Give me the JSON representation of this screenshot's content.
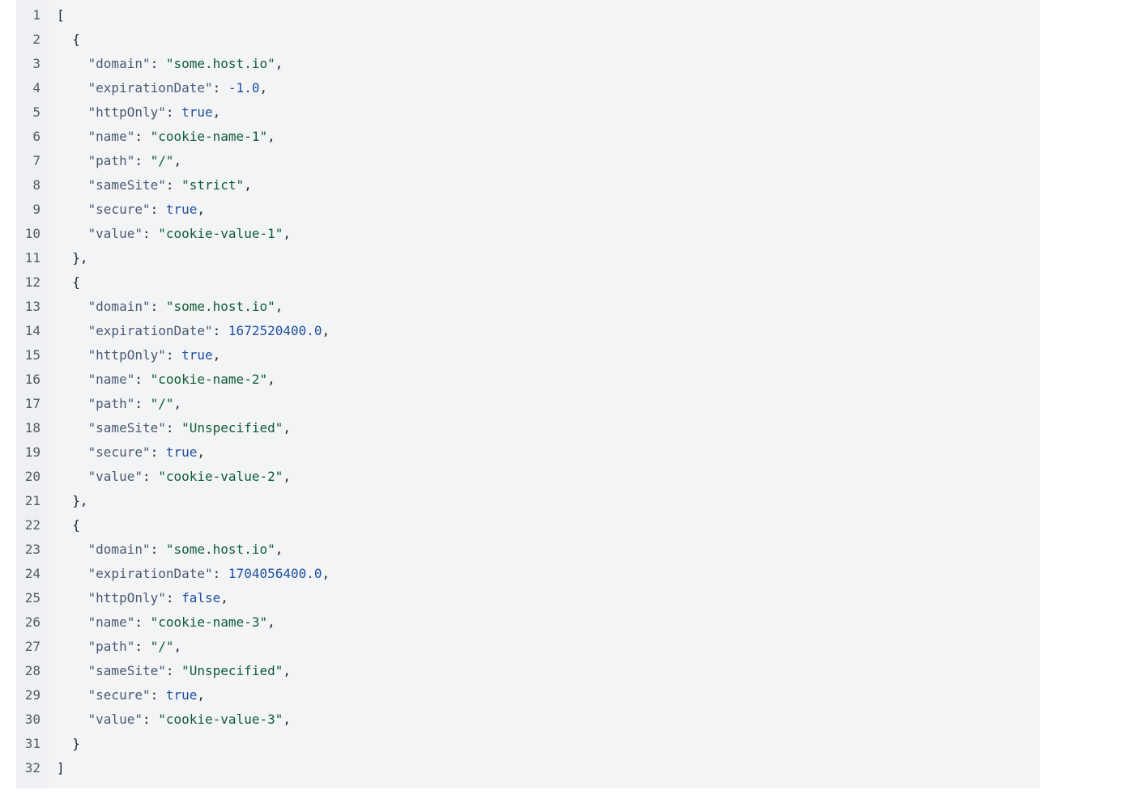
{
  "colors": {
    "background": "#ffffff",
    "code_bg": "#f3f4f6",
    "gutter_bg": "#eef0f3",
    "line_number": "#555b63",
    "key": "#4a5a73",
    "string": "#0f5c36",
    "number": "#1f4fa0",
    "keyword": "#1f4fa0",
    "punctuation": "#24292e"
  },
  "lines": [
    {
      "n": "1",
      "tokens": [
        {
          "t": "punc",
          "v": "["
        }
      ]
    },
    {
      "n": "2",
      "tokens": [
        {
          "t": "indent",
          "v": "  "
        },
        {
          "t": "punc",
          "v": "{"
        }
      ]
    },
    {
      "n": "3",
      "tokens": [
        {
          "t": "indent",
          "v": "    "
        },
        {
          "t": "key",
          "v": "\"domain\""
        },
        {
          "t": "punc",
          "v": ": "
        },
        {
          "t": "str",
          "v": "\"some.host.io\""
        },
        {
          "t": "punc",
          "v": ","
        }
      ]
    },
    {
      "n": "4",
      "tokens": [
        {
          "t": "indent",
          "v": "    "
        },
        {
          "t": "key",
          "v": "\"expirationDate\""
        },
        {
          "t": "punc",
          "v": ": "
        },
        {
          "t": "num",
          "v": "-1.0"
        },
        {
          "t": "punc",
          "v": ","
        }
      ]
    },
    {
      "n": "5",
      "tokens": [
        {
          "t": "indent",
          "v": "    "
        },
        {
          "t": "key",
          "v": "\"httpOnly\""
        },
        {
          "t": "punc",
          "v": ": "
        },
        {
          "t": "kw",
          "v": "true"
        },
        {
          "t": "punc",
          "v": ","
        }
      ]
    },
    {
      "n": "6",
      "tokens": [
        {
          "t": "indent",
          "v": "    "
        },
        {
          "t": "key",
          "v": "\"name\""
        },
        {
          "t": "punc",
          "v": ": "
        },
        {
          "t": "str",
          "v": "\"cookie-name-1\""
        },
        {
          "t": "punc",
          "v": ","
        }
      ]
    },
    {
      "n": "7",
      "tokens": [
        {
          "t": "indent",
          "v": "    "
        },
        {
          "t": "key",
          "v": "\"path\""
        },
        {
          "t": "punc",
          "v": ": "
        },
        {
          "t": "str",
          "v": "\"/\""
        },
        {
          "t": "punc",
          "v": ","
        }
      ]
    },
    {
      "n": "8",
      "tokens": [
        {
          "t": "indent",
          "v": "    "
        },
        {
          "t": "key",
          "v": "\"sameSite\""
        },
        {
          "t": "punc",
          "v": ": "
        },
        {
          "t": "str",
          "v": "\"strict\""
        },
        {
          "t": "punc",
          "v": ","
        }
      ]
    },
    {
      "n": "9",
      "tokens": [
        {
          "t": "indent",
          "v": "    "
        },
        {
          "t": "key",
          "v": "\"secure\""
        },
        {
          "t": "punc",
          "v": ": "
        },
        {
          "t": "kw",
          "v": "true"
        },
        {
          "t": "punc",
          "v": ","
        }
      ]
    },
    {
      "n": "10",
      "tokens": [
        {
          "t": "indent",
          "v": "    "
        },
        {
          "t": "key",
          "v": "\"value\""
        },
        {
          "t": "punc",
          "v": ": "
        },
        {
          "t": "str",
          "v": "\"cookie-value-1\""
        },
        {
          "t": "punc",
          "v": ","
        }
      ]
    },
    {
      "n": "11",
      "tokens": [
        {
          "t": "indent",
          "v": "  "
        },
        {
          "t": "punc",
          "v": "},"
        }
      ]
    },
    {
      "n": "12",
      "tokens": [
        {
          "t": "indent",
          "v": "  "
        },
        {
          "t": "punc",
          "v": "{"
        }
      ]
    },
    {
      "n": "13",
      "tokens": [
        {
          "t": "indent",
          "v": "    "
        },
        {
          "t": "key",
          "v": "\"domain\""
        },
        {
          "t": "punc",
          "v": ": "
        },
        {
          "t": "str",
          "v": "\"some.host.io\""
        },
        {
          "t": "punc",
          "v": ","
        }
      ]
    },
    {
      "n": "14",
      "tokens": [
        {
          "t": "indent",
          "v": "    "
        },
        {
          "t": "key",
          "v": "\"expirationDate\""
        },
        {
          "t": "punc",
          "v": ": "
        },
        {
          "t": "num",
          "v": "1672520400.0"
        },
        {
          "t": "punc",
          "v": ","
        }
      ]
    },
    {
      "n": "15",
      "tokens": [
        {
          "t": "indent",
          "v": "    "
        },
        {
          "t": "key",
          "v": "\"httpOnly\""
        },
        {
          "t": "punc",
          "v": ": "
        },
        {
          "t": "kw",
          "v": "true"
        },
        {
          "t": "punc",
          "v": ","
        }
      ]
    },
    {
      "n": "16",
      "tokens": [
        {
          "t": "indent",
          "v": "    "
        },
        {
          "t": "key",
          "v": "\"name\""
        },
        {
          "t": "punc",
          "v": ": "
        },
        {
          "t": "str",
          "v": "\"cookie-name-2\""
        },
        {
          "t": "punc",
          "v": ","
        }
      ]
    },
    {
      "n": "17",
      "tokens": [
        {
          "t": "indent",
          "v": "    "
        },
        {
          "t": "key",
          "v": "\"path\""
        },
        {
          "t": "punc",
          "v": ": "
        },
        {
          "t": "str",
          "v": "\"/\""
        },
        {
          "t": "punc",
          "v": ","
        }
      ]
    },
    {
      "n": "18",
      "tokens": [
        {
          "t": "indent",
          "v": "    "
        },
        {
          "t": "key",
          "v": "\"sameSite\""
        },
        {
          "t": "punc",
          "v": ": "
        },
        {
          "t": "str",
          "v": "\"Unspecified\""
        },
        {
          "t": "punc",
          "v": ","
        }
      ]
    },
    {
      "n": "19",
      "tokens": [
        {
          "t": "indent",
          "v": "    "
        },
        {
          "t": "key",
          "v": "\"secure\""
        },
        {
          "t": "punc",
          "v": ": "
        },
        {
          "t": "kw",
          "v": "true"
        },
        {
          "t": "punc",
          "v": ","
        }
      ]
    },
    {
      "n": "20",
      "tokens": [
        {
          "t": "indent",
          "v": "    "
        },
        {
          "t": "key",
          "v": "\"value\""
        },
        {
          "t": "punc",
          "v": ": "
        },
        {
          "t": "str",
          "v": "\"cookie-value-2\""
        },
        {
          "t": "punc",
          "v": ","
        }
      ]
    },
    {
      "n": "21",
      "tokens": [
        {
          "t": "indent",
          "v": "  "
        },
        {
          "t": "punc",
          "v": "},"
        }
      ]
    },
    {
      "n": "22",
      "tokens": [
        {
          "t": "indent",
          "v": "  "
        },
        {
          "t": "punc",
          "v": "{"
        }
      ]
    },
    {
      "n": "23",
      "tokens": [
        {
          "t": "indent",
          "v": "    "
        },
        {
          "t": "key",
          "v": "\"domain\""
        },
        {
          "t": "punc",
          "v": ": "
        },
        {
          "t": "str",
          "v": "\"some.host.io\""
        },
        {
          "t": "punc",
          "v": ","
        }
      ]
    },
    {
      "n": "24",
      "tokens": [
        {
          "t": "indent",
          "v": "    "
        },
        {
          "t": "key",
          "v": "\"expirationDate\""
        },
        {
          "t": "punc",
          "v": ": "
        },
        {
          "t": "num",
          "v": "1704056400.0"
        },
        {
          "t": "punc",
          "v": ","
        }
      ]
    },
    {
      "n": "25",
      "tokens": [
        {
          "t": "indent",
          "v": "    "
        },
        {
          "t": "key",
          "v": "\"httpOnly\""
        },
        {
          "t": "punc",
          "v": ": "
        },
        {
          "t": "kw",
          "v": "false"
        },
        {
          "t": "punc",
          "v": ","
        }
      ]
    },
    {
      "n": "26",
      "tokens": [
        {
          "t": "indent",
          "v": "    "
        },
        {
          "t": "key",
          "v": "\"name\""
        },
        {
          "t": "punc",
          "v": ": "
        },
        {
          "t": "str",
          "v": "\"cookie-name-3\""
        },
        {
          "t": "punc",
          "v": ","
        }
      ]
    },
    {
      "n": "27",
      "tokens": [
        {
          "t": "indent",
          "v": "    "
        },
        {
          "t": "key",
          "v": "\"path\""
        },
        {
          "t": "punc",
          "v": ": "
        },
        {
          "t": "str",
          "v": "\"/\""
        },
        {
          "t": "punc",
          "v": ","
        }
      ]
    },
    {
      "n": "28",
      "tokens": [
        {
          "t": "indent",
          "v": "    "
        },
        {
          "t": "key",
          "v": "\"sameSite\""
        },
        {
          "t": "punc",
          "v": ": "
        },
        {
          "t": "str",
          "v": "\"Unspecified\""
        },
        {
          "t": "punc",
          "v": ","
        }
      ]
    },
    {
      "n": "29",
      "tokens": [
        {
          "t": "indent",
          "v": "    "
        },
        {
          "t": "key",
          "v": "\"secure\""
        },
        {
          "t": "punc",
          "v": ": "
        },
        {
          "t": "kw",
          "v": "true"
        },
        {
          "t": "punc",
          "v": ","
        }
      ]
    },
    {
      "n": "30",
      "tokens": [
        {
          "t": "indent",
          "v": "    "
        },
        {
          "t": "key",
          "v": "\"value\""
        },
        {
          "t": "punc",
          "v": ": "
        },
        {
          "t": "str",
          "v": "\"cookie-value-3\""
        },
        {
          "t": "punc",
          "v": ","
        }
      ]
    },
    {
      "n": "31",
      "tokens": [
        {
          "t": "indent",
          "v": "  "
        },
        {
          "t": "punc",
          "v": "}"
        }
      ]
    },
    {
      "n": "32",
      "tokens": [
        {
          "t": "punc",
          "v": "]"
        }
      ]
    }
  ]
}
